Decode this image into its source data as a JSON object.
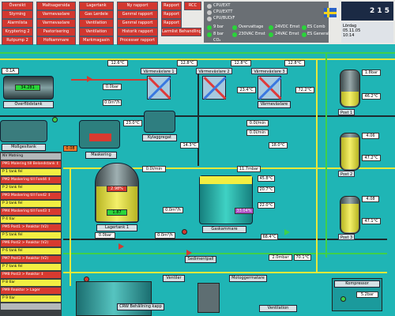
{
  "nav_rows": [
    [
      "Översikt",
      "Maltsagersida",
      "Lagertank",
      "Ny rapport",
      "Rapport",
      "RCC"
    ],
    [
      "Styrning",
      "Varmevaxlare",
      "Gas Lerdele",
      "Genrral rapport",
      "Rapport"
    ],
    [
      "Alarmlista",
      "Varmevaxlare",
      "Ventilation",
      "Genrral rapport",
      "Rapport"
    ],
    [
      "Kryptering 2",
      "Pastorisering",
      "Ventilation",
      "Historik rapport",
      "Larmlist Behandling"
    ],
    [
      "Rutpump 2",
      "Hofkammare",
      "Markmagasin",
      "Processer rapport"
    ]
  ],
  "status": {
    "cpu_lines": [
      "CPU/EXT",
      "CPU/EXTT",
      "CPU/BUD/F"
    ],
    "pressure_items": [
      "9 bar",
      "Overvattage",
      "24VDC Emst",
      "ES Comb",
      "Panna"
    ],
    "alarm_items": [
      "8 bar",
      "230VAC Emst",
      "24VAC Emst",
      "ES General",
      "LSO"
    ],
    "co2_label": "CO₂"
  },
  "logo_text": "2 1 5",
  "datebox": {
    "day": "Lördag",
    "date": "05.11.05",
    "time": "10:14"
  },
  "tanks_top": {
    "overflow_label": "Överflödstank",
    "mix_label": "Maskering",
    "cooling_label": "Kylaggregat",
    "value_top_left": "0.1A",
    "tank_level": "34.281",
    "v1": "12.6°C",
    "v2": "0.0bar",
    "v3": "0.0m³/h"
  },
  "heat_exchangers": [
    {
      "label": "Värmeväxlare 1",
      "temp": "12.8°C"
    },
    {
      "label": "Värmeväxlare 2",
      "temp": "12.8°C"
    },
    {
      "label": "Värmeväxlare 3",
      "temp": "12.8°C"
    }
  ],
  "mid_values": [
    "14.3°C",
    "23.0°C",
    "23.4°C",
    "72.2°C",
    "18.0°C",
    "0.0l/min",
    "0.0l/min"
  ],
  "rack_label": "Värmeväxlare",
  "mixtank": {
    "label": "Moßgesltank",
    "red_value": "0.08"
  },
  "lagertank": {
    "label": "Lagertank 1",
    "pct": "2.98%",
    "level": "1.87",
    "v1": "0.0l/min",
    "v2": "0.0m³/h",
    "v3": "0.0bar",
    "v4": "0.0m³/h"
  },
  "gaskammare": {
    "label": "Gaskammare",
    "pct": "33.04%",
    "v1": "11.7mbar",
    "v2": "45.8°C",
    "v3": "20.7°C",
    "v4": "22.0°C",
    "v5": "68.4°C",
    "v6": "2.0mbar",
    "v7": "70.1°C"
  },
  "posts": [
    {
      "label": "Post 1",
      "v1": "1.8bar",
      "v2": "46.2°C"
    },
    {
      "label": "Post 2",
      "v1": "4.06",
      "v2": "47.2°C"
    },
    {
      "label": "Post 3",
      "v1": "4.08",
      "v2": "47.1°C"
    }
  ],
  "bottom": {
    "valve_label": "Ventiler",
    "motor_label": "Motoggermatare",
    "fan_label": "Ventilation",
    "bottom_mid": "CRW Behållning kapp",
    "compressor_label": "Kompressor",
    "compressor_value": "5.2bar",
    "settle_label": "Sedimentpall"
  },
  "left_panel": [
    {
      "text": "NV Matning",
      "style": "gry"
    },
    {
      "text": "PM1 Malering till Belandstank ↕",
      "style": "red"
    },
    {
      "text": "P 1 tank fel",
      "style": "yel"
    },
    {
      "text": "PM2 Maskering till Fond4 ↕",
      "style": "red"
    },
    {
      "text": "P 2 tank fel",
      "style": "yel"
    },
    {
      "text": "PM3 Maskering till Fond2 ↕",
      "style": "red"
    },
    {
      "text": "P 3 tank fel",
      "style": "yel"
    },
    {
      "text": "PM4 Maskering till Fond3 ↕",
      "style": "red"
    },
    {
      "text": "P 4 tlar",
      "style": "yel"
    },
    {
      "text": "PM5 Post1 > Reaktor (V2)",
      "style": "red"
    },
    {
      "text": "P 5 tank fel",
      "style": "yel"
    },
    {
      "text": "PM6 Post2 > Reaktor (V2)",
      "style": "red"
    },
    {
      "text": "P 6 tank fel",
      "style": "yel"
    },
    {
      "text": "PM7 Post3 > Reaktor (V2)",
      "style": "red"
    },
    {
      "text": "P 7 tank fel",
      "style": "yel"
    },
    {
      "text": "PM8 Post3 > Reaktor ↕",
      "style": "red"
    },
    {
      "text": "P 8 tlar",
      "style": "yel"
    },
    {
      "text": "PM9 Reaktor > Lager",
      "style": "red"
    },
    {
      "text": "P 9 tlar",
      "style": "yel"
    },
    {
      "text": "",
      "style": "gry"
    }
  ]
}
